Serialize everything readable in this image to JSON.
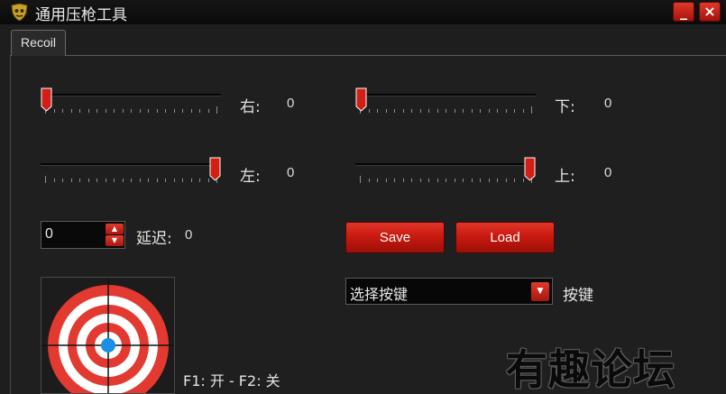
{
  "window": {
    "title": "通用压枪工具",
    "minimize_label": "_",
    "close_label": "×"
  },
  "tabs": [
    {
      "label": "Recoil",
      "selected": true
    }
  ],
  "sliders": {
    "right": {
      "label": "右:",
      "value": "0",
      "level": 0.0
    },
    "down": {
      "label": "下:",
      "value": "0",
      "level": 0.0
    },
    "left": {
      "label": "左:",
      "value": "0",
      "level": 1.0
    },
    "up": {
      "label": "上:",
      "value": "0",
      "level": 1.0
    }
  },
  "delay": {
    "input_value": "0",
    "label": "延迟:",
    "value": "0"
  },
  "buttons": {
    "save_label": "Save",
    "load_label": "Load"
  },
  "key_select": {
    "selected": "选择按键",
    "label": "按键"
  },
  "hotkeys_text": "F1: 开 - F2: 关",
  "watermark": "有趣论坛",
  "colors": {
    "accent_red": "#d11f15",
    "crosshair_blue": "#1b8fe8",
    "background": "#1e1e1e"
  }
}
